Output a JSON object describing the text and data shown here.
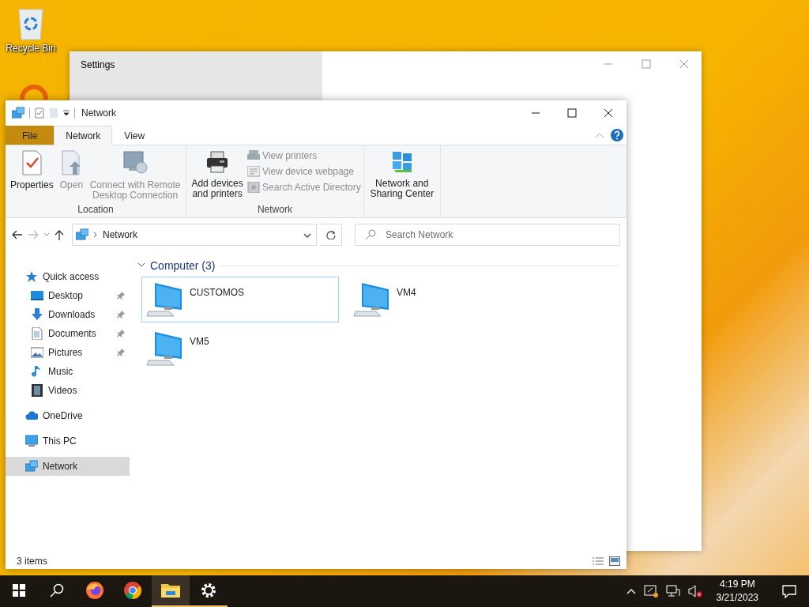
{
  "desktop": {
    "icons": [
      {
        "label": "Recycle Bin",
        "kind": "recycle"
      },
      {
        "kind": "ring"
      }
    ]
  },
  "settings_window": {
    "title": "Settings"
  },
  "explorer": {
    "title": "Network",
    "ribbon_tabs": [
      {
        "label": "File",
        "kind": "file",
        "selected": false
      },
      {
        "label": "Network",
        "kind": "tab",
        "selected": true
      },
      {
        "label": "View",
        "kind": "tab",
        "selected": false
      }
    ],
    "ribbon_groups": [
      {
        "label": "Location",
        "buttons": [
          {
            "label": "Properties",
            "kind": "properties",
            "disabled": false
          },
          {
            "label": "Open",
            "kind": "open",
            "disabled": true
          },
          {
            "label": "Connect with Remote Desktop Connection",
            "kind": "remote",
            "disabled": true
          }
        ]
      },
      {
        "label": "Network",
        "buttons": [
          {
            "label": "Add devices and printers",
            "kind": "printer",
            "disabled": false
          }
        ],
        "small_buttons": [
          {
            "label": "View printers",
            "disabled": true
          },
          {
            "label": "View device webpage",
            "disabled": true
          },
          {
            "label": "Search Active Directory",
            "disabled": true
          }
        ]
      },
      {
        "buttons": [
          {
            "label": "Network and Sharing Center",
            "kind": "sharing",
            "disabled": false
          }
        ]
      }
    ],
    "address": {
      "path": "Network"
    },
    "search": {
      "placeholder": "Search Network"
    },
    "nav_pane": {
      "items": [
        {
          "label": "Quick access",
          "kind": "star",
          "selected": false,
          "children": [
            {
              "label": "Desktop",
              "kind": "desktop",
              "pinned": true,
              "selected": false
            },
            {
              "label": "Downloads",
              "kind": "download",
              "pinned": true,
              "selected": false
            },
            {
              "label": "Documents",
              "kind": "document",
              "pinned": true,
              "selected": false
            },
            {
              "label": "Pictures",
              "kind": "pictures",
              "pinned": true,
              "selected": false
            },
            {
              "label": "Music",
              "kind": "music",
              "pinned": false,
              "selected": false
            },
            {
              "label": "Videos",
              "kind": "videos",
              "pinned": false,
              "selected": false
            }
          ]
        },
        {
          "label": "OneDrive",
          "kind": "cloud",
          "selected": false
        },
        {
          "label": "This PC",
          "kind": "pc",
          "selected": false
        },
        {
          "label": "Network",
          "kind": "network",
          "selected": true
        }
      ]
    },
    "group": {
      "label": "Computer (3)",
      "expanded": true
    },
    "items": [
      {
        "name": "CUSTOMOS",
        "selected": true
      },
      {
        "name": "VM4",
        "selected": false
      },
      {
        "name": "VM5",
        "selected": false
      }
    ],
    "status_bar": {
      "text": "3 items"
    }
  },
  "taskbar": {
    "apps": [
      {
        "kind": "start",
        "selected": false,
        "running": false
      },
      {
        "kind": "search",
        "selected": false,
        "running": false
      },
      {
        "kind": "firefox",
        "selected": false,
        "running": false
      },
      {
        "kind": "chrome",
        "selected": false,
        "running": false
      },
      {
        "kind": "explorer",
        "selected": true,
        "running": true
      },
      {
        "kind": "settings",
        "selected": false,
        "running": true
      }
    ],
    "clock": {
      "time": "4:19 PM",
      "date": "3/21/2023"
    }
  }
}
